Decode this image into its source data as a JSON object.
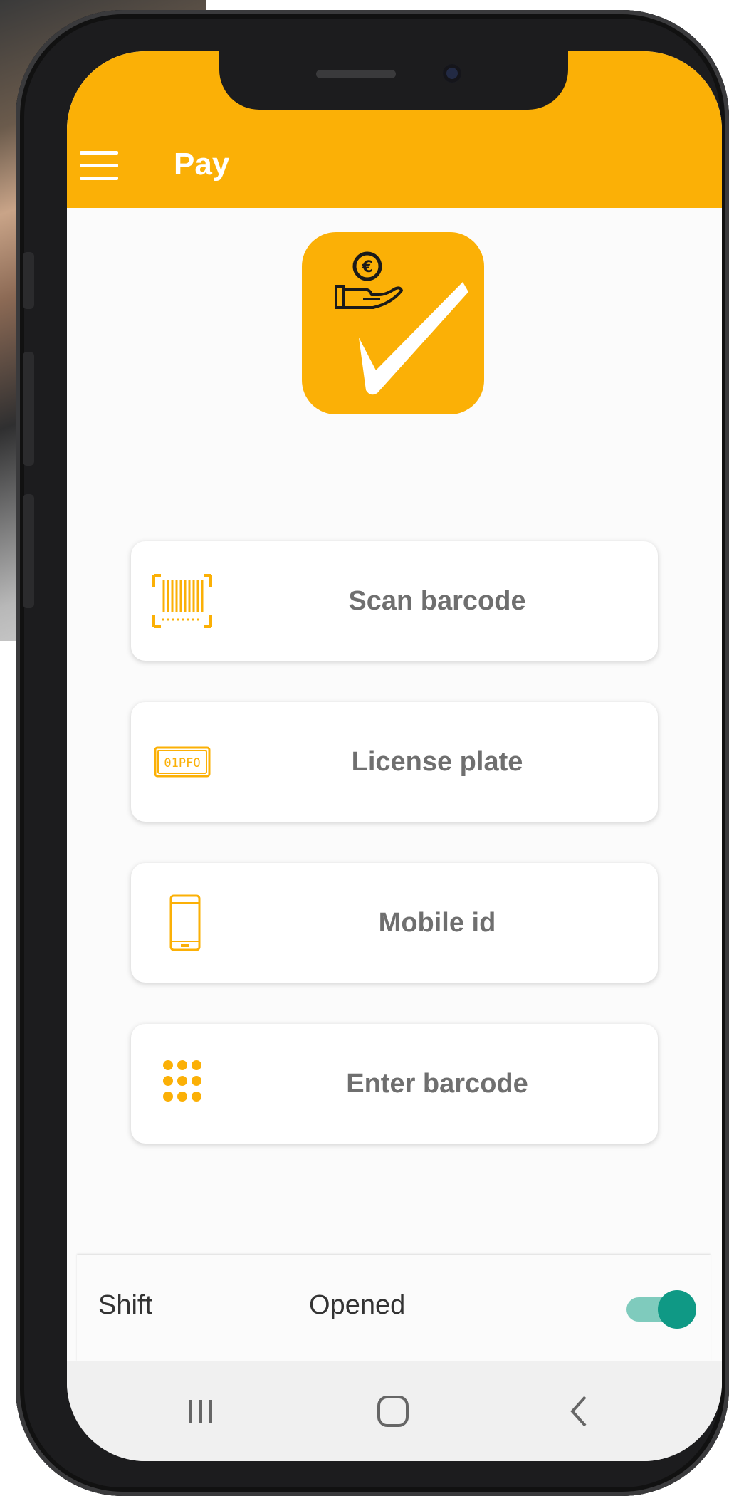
{
  "app": {
    "title": "Pay",
    "accent_color": "#fbb006",
    "header_icon": "hamburger-menu-icon",
    "logo_icon": "pay-euro-hand-check-logo"
  },
  "actions": [
    {
      "label": "Scan barcode",
      "icon": "barcode-scan-icon"
    },
    {
      "label": "License plate",
      "icon": "license-plate-icon"
    },
    {
      "label": "Mobile id",
      "icon": "mobile-phone-icon"
    },
    {
      "label": "Enter barcode",
      "icon": "keypad-icon"
    }
  ],
  "license_plate_text": "01PFO",
  "shift": {
    "label": "Shift",
    "status": "Opened",
    "toggle_on": true,
    "toggle_color": "#0f9985"
  },
  "system_nav": {
    "recents_icon": "recents-icon",
    "home_icon": "home-icon",
    "back_icon": "back-icon"
  }
}
